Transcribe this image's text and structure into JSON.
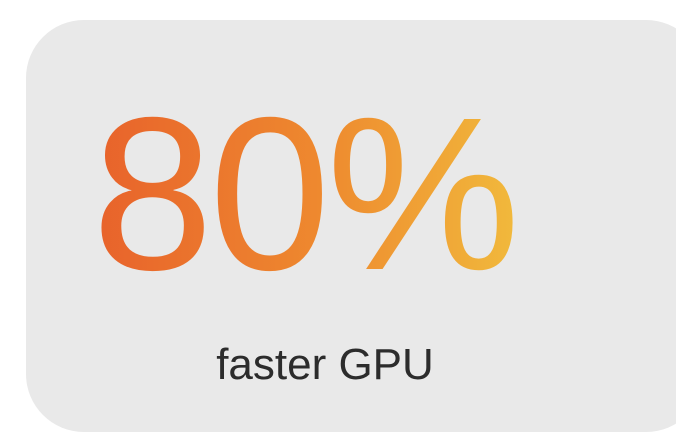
{
  "stat": {
    "value": "80%",
    "caption": "faster GPU"
  },
  "colors": {
    "card_background": "#e9e9e9",
    "value_gradient_start": "#e8622b",
    "value_gradient_mid": "#ee8a2f",
    "value_gradient_end": "#f1b93c",
    "caption_text": "#2c2c2c"
  }
}
